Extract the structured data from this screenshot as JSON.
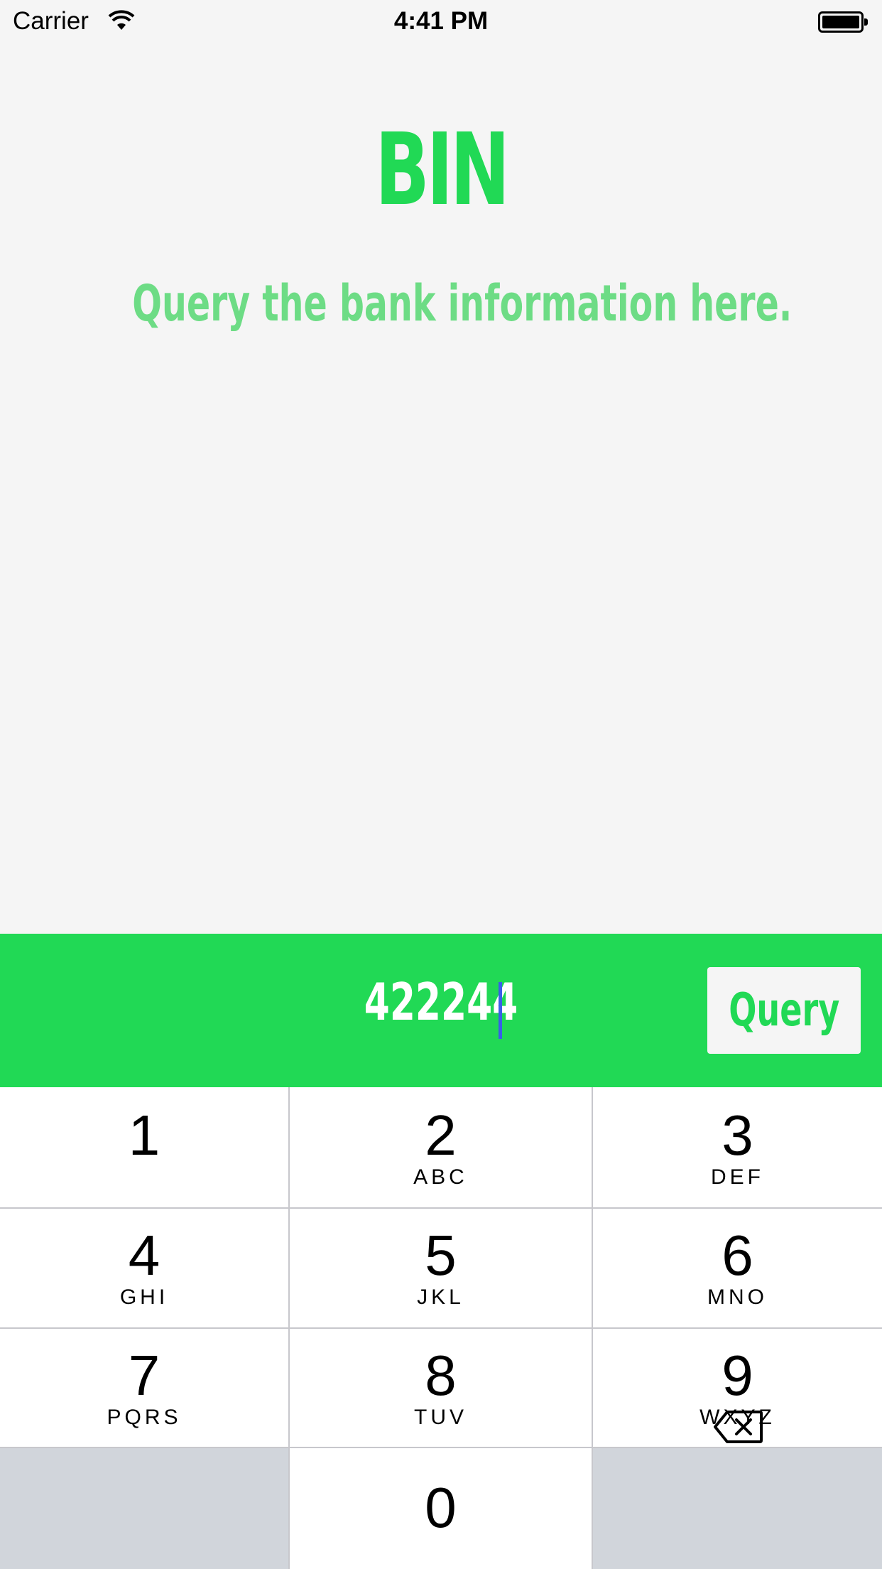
{
  "status_bar": {
    "carrier": "Carrier",
    "time": "4:41 PM"
  },
  "app": {
    "title": "BIN",
    "subtitle": "Query the bank information here."
  },
  "query_bar": {
    "input_value": "422244",
    "button_label": "Query"
  },
  "keypad": {
    "keys": [
      {
        "num": "1",
        "letters": ""
      },
      {
        "num": "2",
        "letters": "ABC"
      },
      {
        "num": "3",
        "letters": "DEF"
      },
      {
        "num": "4",
        "letters": "GHI"
      },
      {
        "num": "5",
        "letters": "JKL"
      },
      {
        "num": "6",
        "letters": "MNO"
      },
      {
        "num": "7",
        "letters": "PQRS"
      },
      {
        "num": "8",
        "letters": "TUV"
      },
      {
        "num": "9",
        "letters": "WXYZ"
      },
      {
        "num": "0",
        "letters": ""
      }
    ]
  },
  "colors": {
    "accent": "#21d955",
    "subtitle": "#6ddc85",
    "background": "#f5f5f5",
    "caret": "#3a5ee8"
  }
}
